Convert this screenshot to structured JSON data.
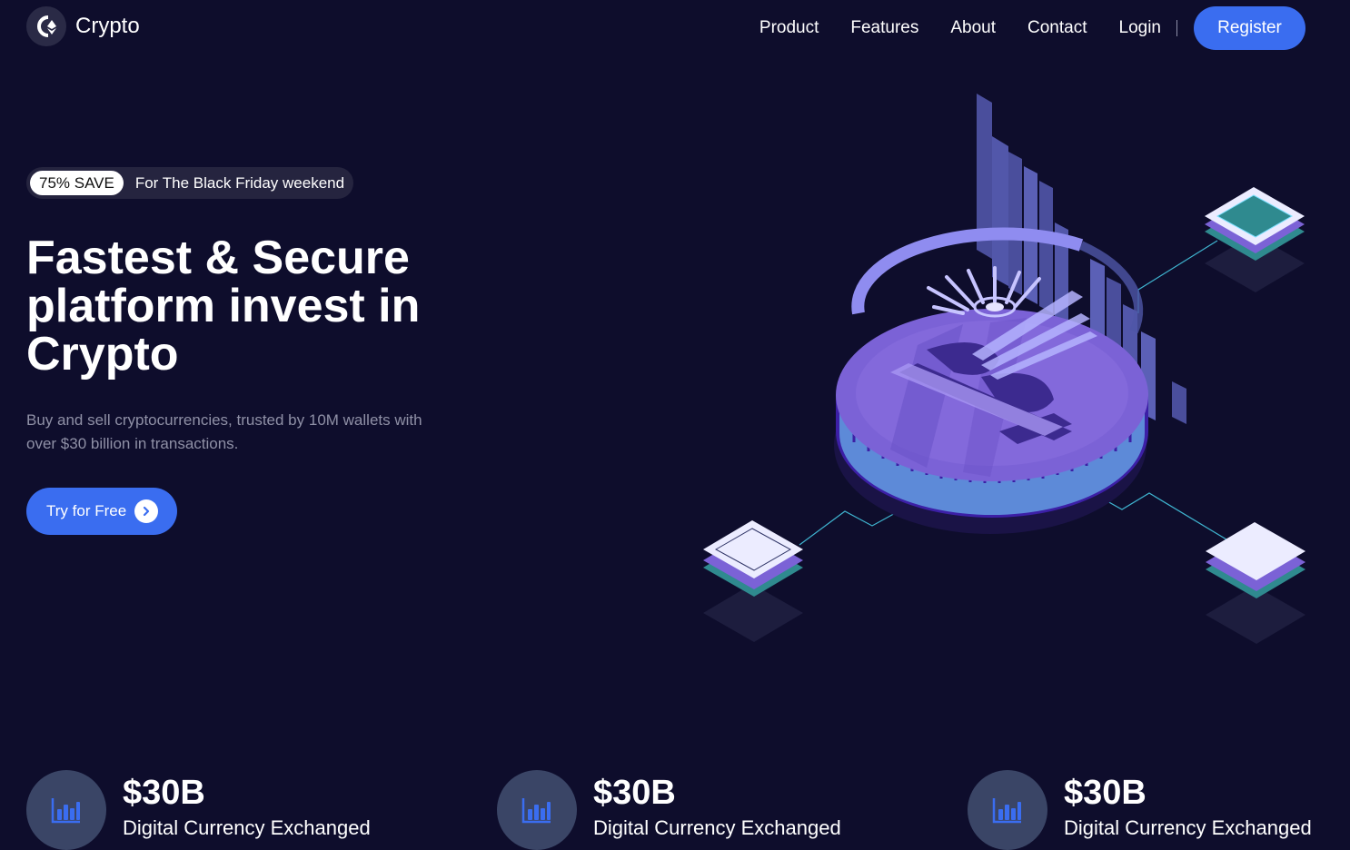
{
  "brand": {
    "name": "Crypto",
    "icon": "crypto-logo-icon"
  },
  "nav": {
    "links": [
      "Product",
      "Features",
      "About",
      "Contact",
      "Login"
    ],
    "register_label": "Register"
  },
  "promo": {
    "badge": "75% SAVE",
    "text": "For The Black Friday weekend"
  },
  "hero": {
    "title": "Fastest & Secure platform invest in Crypto",
    "subtitle": "Buy and sell cryptocurrencies, trusted by 10M wallets with over $30 billion in transactions.",
    "cta_label": "Try for Free",
    "cta_icon": "chevron-right-icon"
  },
  "stats": [
    {
      "value": "$30B",
      "label": "Digital Currency Exchanged",
      "icon": "bar-chart-icon"
    },
    {
      "value": "$30B",
      "label": "Digital Currency Exchanged",
      "icon": "bar-chart-icon"
    },
    {
      "value": "$30B",
      "label": "Digital Currency Exchanged",
      "icon": "bar-chart-icon"
    }
  ],
  "colors": {
    "background": "#0e0d2c",
    "accent": "#3a6df0",
    "muted_text": "#8f90a6",
    "coin": "#7b62d6",
    "teal": "#2f8a8f"
  }
}
